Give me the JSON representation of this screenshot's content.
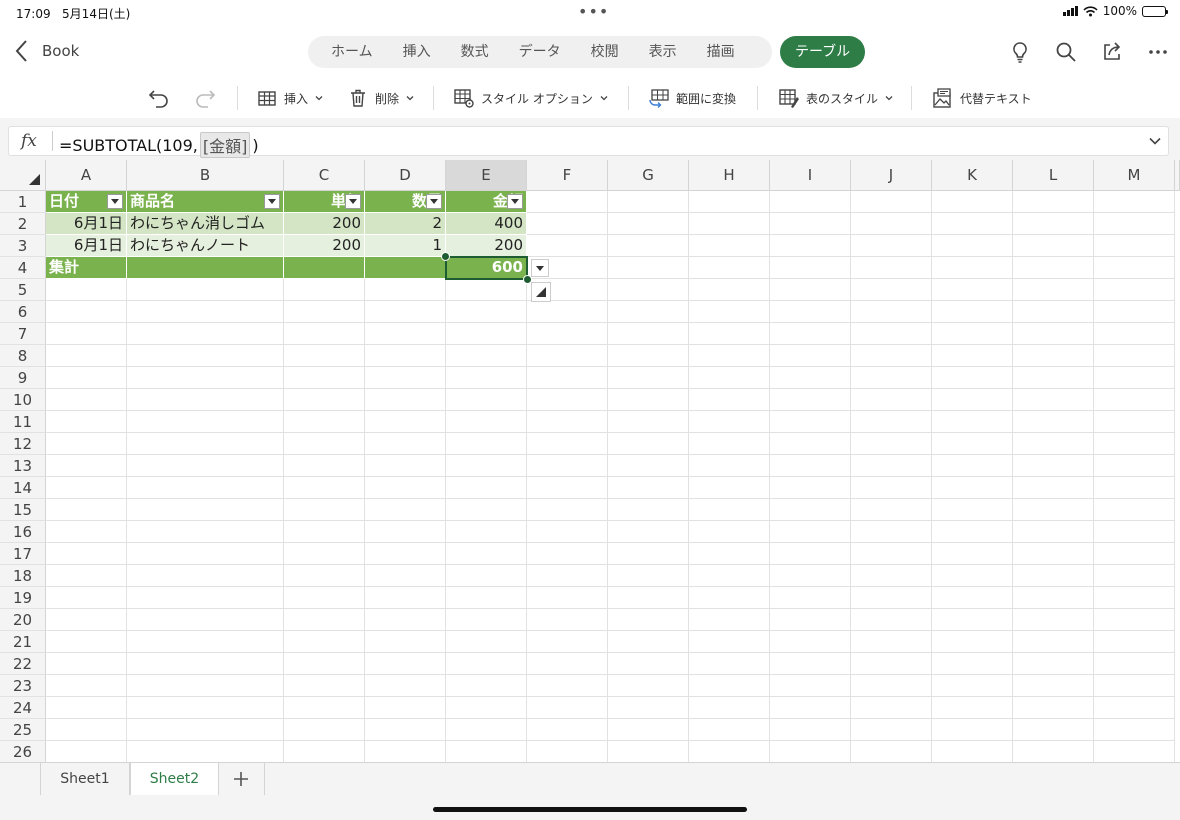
{
  "status": {
    "time": "17:09",
    "date": "5月14日(土)",
    "battery": "100%"
  },
  "header": {
    "back_label": "Book",
    "tabs": [
      "ホーム",
      "挿入",
      "数式",
      "データ",
      "校閲",
      "表示",
      "描画"
    ],
    "active_tab": "テーブル"
  },
  "ribbon": {
    "insert": "挿入",
    "delete": "削除",
    "style_options": "スタイル オプション",
    "convert_range": "範囲に変換",
    "table_style": "表のスタイル",
    "alt_text": "代替テキスト"
  },
  "formula_bar": {
    "fx": "fx",
    "prefix": "=SUBTOTAL(109,",
    "ref": "[金額]",
    "suffix": ")"
  },
  "grid": {
    "columns": [
      "A",
      "B",
      "C",
      "D",
      "E",
      "F",
      "G",
      "H",
      "I",
      "J",
      "K",
      "L",
      "M"
    ],
    "selected_column": "E",
    "selected_cell": "E4",
    "rows": [
      "1",
      "2",
      "3",
      "4",
      "5",
      "6",
      "7",
      "8",
      "9",
      "10",
      "11",
      "12",
      "13",
      "14",
      "15",
      "16",
      "17",
      "18",
      "19",
      "20",
      "21",
      "22",
      "23",
      "24",
      "25",
      "26"
    ],
    "table": {
      "headers": [
        "日付",
        "商品名",
        "単価",
        "数量",
        "金額"
      ],
      "body": [
        [
          "6月1日",
          "わにちゃん消しゴム",
          "200",
          "2",
          "400"
        ],
        [
          "6月1日",
          "わにちゃんノート",
          "200",
          "1",
          "200"
        ]
      ],
      "total": [
        "集計",
        "",
        "",
        "",
        "600"
      ]
    }
  },
  "sheets": {
    "tabs": [
      "Sheet1",
      "Sheet2"
    ],
    "active": "Sheet2",
    "add_label": "+"
  },
  "colors": {
    "accent": "#2e7d47",
    "table_header": "#7ab24d",
    "band_dark": "#d3e5c4",
    "band_light": "#e6f0de"
  }
}
